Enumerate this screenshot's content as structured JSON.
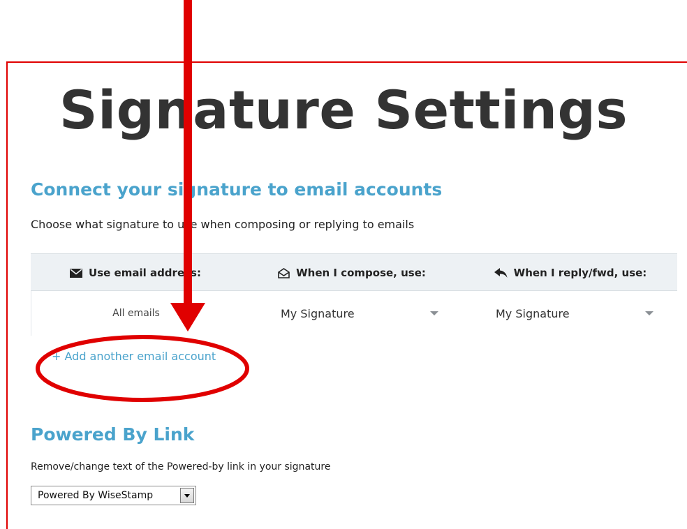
{
  "page": {
    "title": "Signature Settings"
  },
  "connect": {
    "title": "Connect your signature to email accounts",
    "description": "Choose what signature to use when composing or replying to emails",
    "headers": {
      "email": "Use email address:",
      "compose": "When I compose, use:",
      "reply": "When I reply/fwd, use:"
    },
    "row": {
      "email": "All emails",
      "compose": "My Signature",
      "reply": "My Signature"
    },
    "add_link": "+ Add another email account"
  },
  "powered": {
    "title": "Powered By Link",
    "description": "Remove/change text of the Powered-by link in your signature",
    "selected": "Powered By WiseStamp"
  },
  "icons": {
    "email_header": "envelope-icon",
    "compose_header": "open-envelope-icon",
    "reply_header": "reply-arrow-icon"
  },
  "colors": {
    "accent": "#4aa3cc",
    "annotation": "#e00000",
    "header_bg": "#edf1f4"
  }
}
